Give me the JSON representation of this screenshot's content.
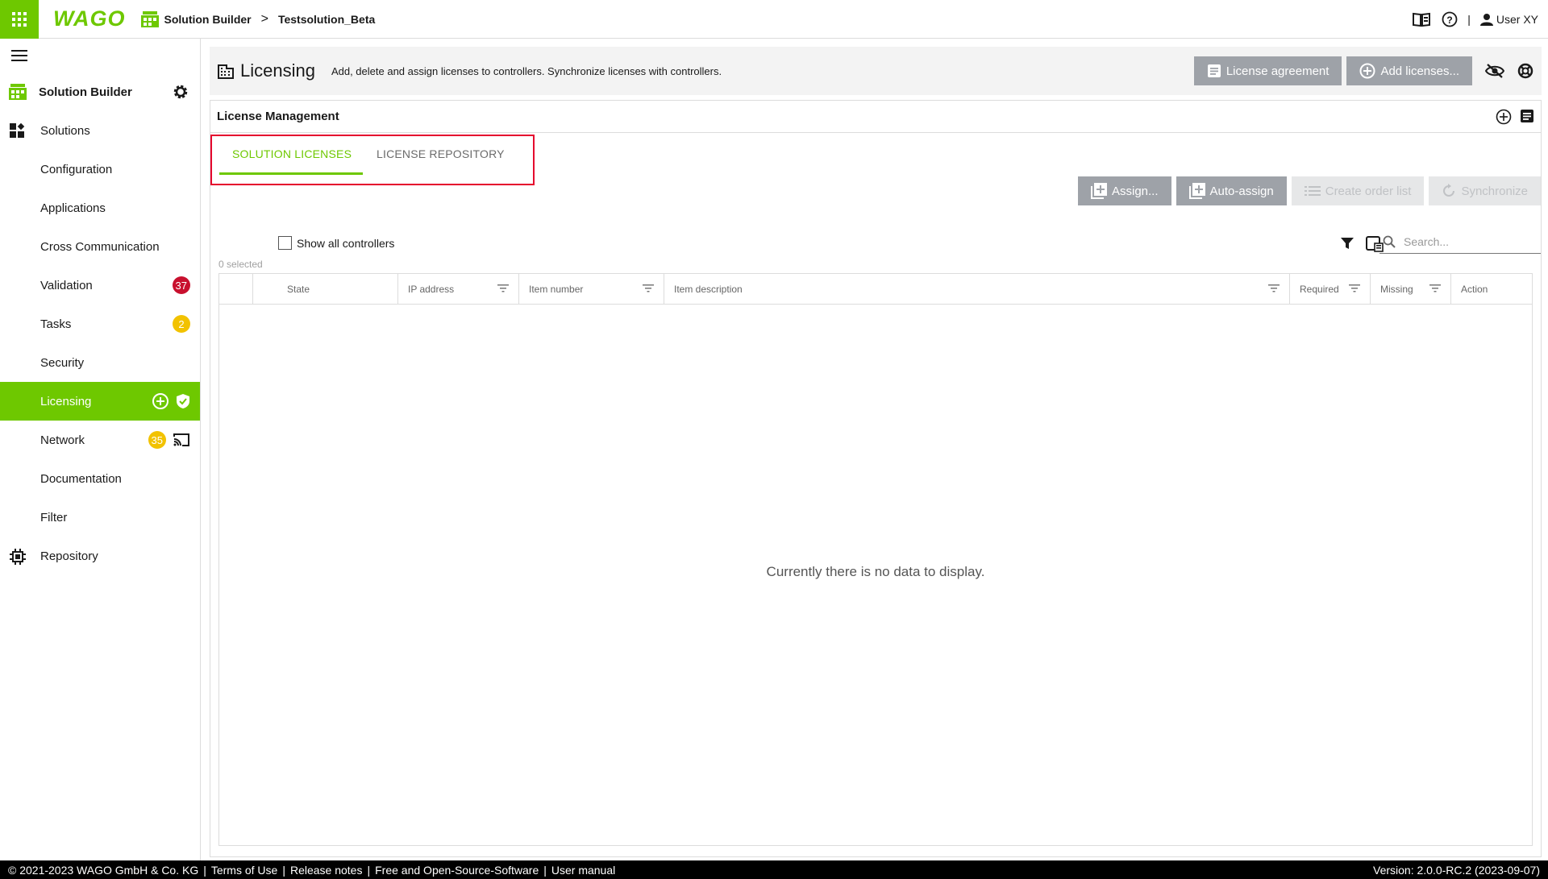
{
  "topbar": {
    "logo": "WAGO",
    "breadcrumb": [
      "Solution Builder",
      "Testsolution_Beta"
    ],
    "user": "User XY",
    "icons": [
      "apps-grid-icon",
      "manual-book-icon",
      "help-icon",
      "user-icon"
    ]
  },
  "sidebar": {
    "header": "Solution Builder",
    "items": [
      {
        "label": "Solutions",
        "icon": "solutions-icon"
      },
      {
        "label": "Configuration"
      },
      {
        "label": "Applications"
      },
      {
        "label": "Cross Communication"
      },
      {
        "label": "Validation",
        "badge": "37",
        "badge_color": "#c8102e"
      },
      {
        "label": "Tasks",
        "badge": "2",
        "badge_color": "#f2c200"
      },
      {
        "label": "Security"
      },
      {
        "label": "Licensing",
        "active": true
      },
      {
        "label": "Network",
        "badge": "35",
        "badge_color": "#f2c200"
      },
      {
        "label": "Documentation"
      },
      {
        "label": "Filter"
      },
      {
        "label": "Repository",
        "icon": "chip-icon"
      }
    ]
  },
  "page": {
    "title": "Licensing",
    "subtitle": "Add, delete and assign licenses to controllers. Synchronize licenses with controllers.",
    "license_agreement": "License agreement",
    "add_licenses": "Add licenses..."
  },
  "panel": {
    "title": "License Management",
    "tabs": [
      "SOLUTION LICENSES",
      "LICENSE REPOSITORY"
    ],
    "toolbar": {
      "assign": "Assign...",
      "auto_assign": "Auto-assign",
      "create_order_list": "Create order list",
      "synchronize": "Synchronize"
    },
    "show_all_controllers": "Show all controllers",
    "selected": "0 selected",
    "search_placeholder": "Search...",
    "columns": [
      "State",
      "IP address",
      "Item number",
      "Item description",
      "Required",
      "Missing",
      "Action"
    ],
    "empty_message": "Currently there is no data to display."
  },
  "footer": {
    "copyright": "© 2021-2023 WAGO GmbH & Co. KG",
    "links": [
      "Terms of Use",
      "Release notes",
      "Free and Open-Source-Software",
      "User manual"
    ],
    "version": "Version: 2.0.0-RC.2 (2023-09-07)"
  },
  "colors": {
    "brand": "#6ec800",
    "highlight": "#e5002d",
    "button": "#9ea2a8"
  }
}
